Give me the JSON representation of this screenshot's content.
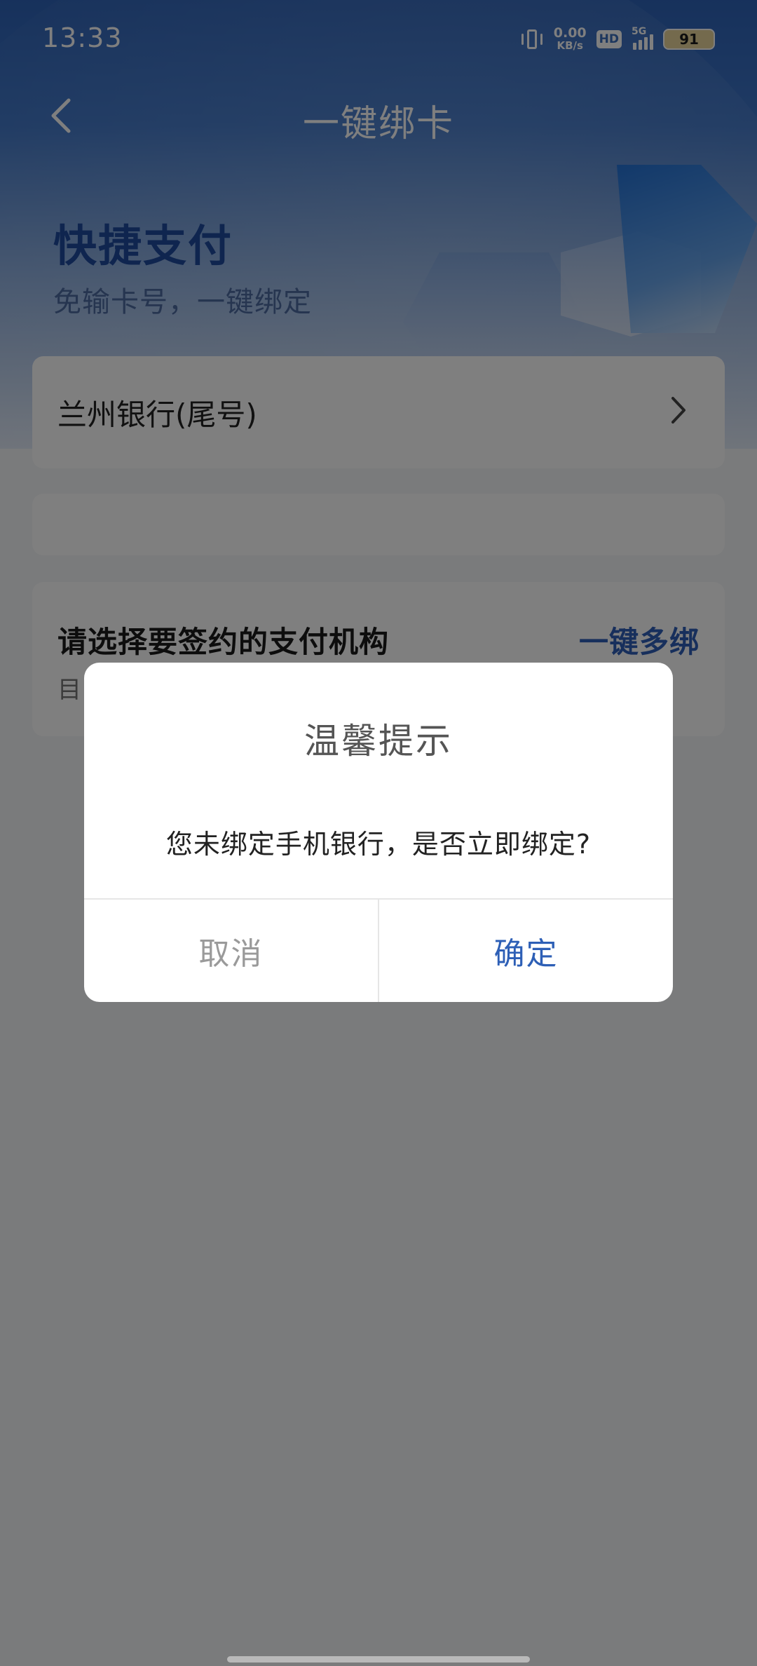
{
  "status_bar": {
    "time": "13:33",
    "net_speed_value": "0.00",
    "net_speed_unit": "KB/s",
    "hd": "HD",
    "signal_label": "5G",
    "battery": "91"
  },
  "nav": {
    "title": "一键绑卡",
    "back_icon": "chevron-left-icon"
  },
  "hero": {
    "title": "快捷支付",
    "subtitle": "免输卡号，一键绑定"
  },
  "bank_card": {
    "name": "兰州银行(尾号)",
    "chevron_icon": "chevron-right-icon"
  },
  "select_section": {
    "title": "请选择要签约的支付机构",
    "action": "一键多绑",
    "subtitle": "目"
  },
  "dialog": {
    "title": "温馨提示",
    "message": "您未绑定手机银行，是否立即绑定?",
    "cancel": "取消",
    "confirm": "确定"
  },
  "colors": {
    "accent": "#2d5fb6",
    "hero_title": "#1e4a9e",
    "overlay": "rgba(0,0,0,0.5)"
  }
}
